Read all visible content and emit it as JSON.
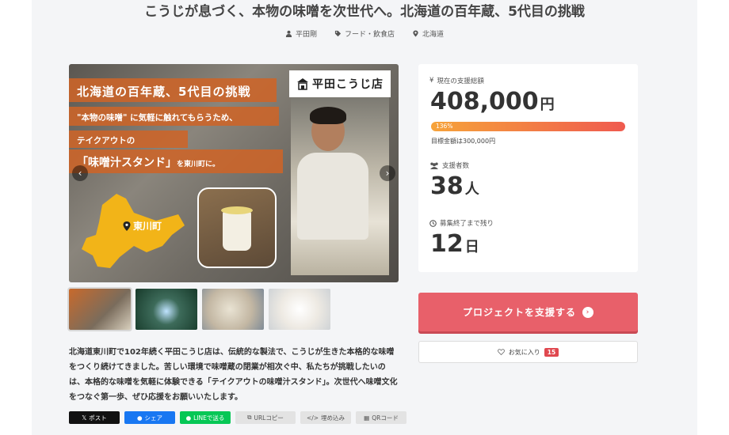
{
  "project": {
    "title": "こうじが息づく、本物の味噌を次世代へ。北海道の百年蔵、5代目の挑戦",
    "owner": "平田剛",
    "category": "フード・飲食店",
    "location": "北海道"
  },
  "hero": {
    "banner_line1": "北海道の百年蔵、5代目の挑戦",
    "banner_line2": "\"本物の味噌\" に気軽に触れてもらうため、",
    "banner_line3": "テイクアウトの",
    "banner_line4_main": "「味噌汁スタンド」",
    "banner_line4_tail": "を東川町に。",
    "logo_text": "平田こうじ店",
    "map_label": "東川町"
  },
  "description": "北海道東川町で102年続く平田こうじ店は、伝統的な製法で、こうじが生きた本格的な味噌をつくり続けてきました。苦しい環境で味噌蔵の閉業が相次ぐ中、私たちが挑戦したいのは、本格的な味噌を気軽に体験できる「テイクアウトの味噌汁スタンド」。次世代へ味噌文化をつなぐ第一歩、ぜひ応援をお願いいたします。",
  "share": {
    "x": "ポスト",
    "facebook": "シェア",
    "line": "LINEで送る",
    "url": "URLコピー",
    "embed": "埋め込み",
    "qr": "QRコード"
  },
  "stats": {
    "total_label": "現在の支援総額",
    "total_value": "408,000",
    "total_unit": "円",
    "progress_text": "136%",
    "progress_percent": 136,
    "goal_text": "目標金額は300,000円",
    "supporters_label": "支援者数",
    "supporters_value": "38",
    "supporters_unit": "人",
    "remaining_label": "募集終了まで残り",
    "remaining_value": "12",
    "remaining_unit": "日"
  },
  "actions": {
    "support_label": "プロジェクトを支援する",
    "favorite_label": "お気に入り",
    "favorite_count": "15"
  },
  "colors": {
    "accent": "#e8606a",
    "progress_start": "#f6a33a",
    "progress_end": "#ef5a4f",
    "banner": "#cd6428"
  }
}
